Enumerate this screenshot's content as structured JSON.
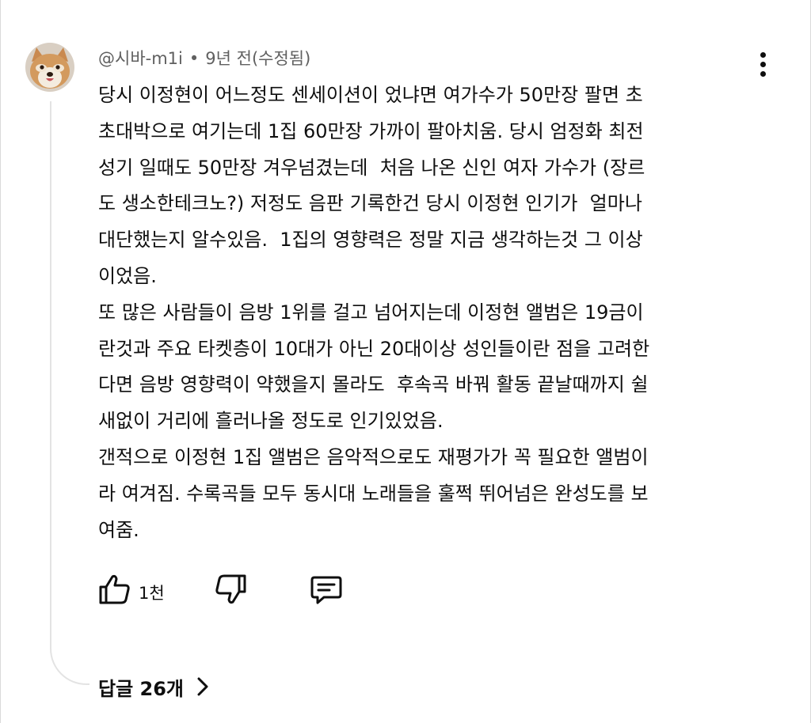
{
  "comment": {
    "author": "@시바-m1i",
    "separator": "•",
    "timestamp": "9년 전(수정됨)",
    "lines": [
      "당시 이정현이 어느정도 센세이션이 었냐면 여가수가 50만장 팔면 초",
      "초대박으로 여기는데 1집 60만장 가까이 팔아치움. 당시 엄정화 최전",
      "성기 일때도 50만장 겨우넘겼는데  처음 나온 신인 여자 가수가 (장르",
      "도 생소한테크노?) 저정도 음판 기록한건 당시 이정현 인기가  얼마나",
      "대단했는지 알수있음.  1집의 영향력은 정말 지금 생각하는것 그 이상",
      "이었음.",
      "또 많은 사람들이 음방 1위를 걸고 넘어지는데 이정현 앨범은 19금이",
      "란것과 주요 타켓층이 10대가 아닌 20대이상 성인들이란 점을 고려한",
      "다면 음방 영향력이 약했을지 몰라도  후속곡 바꿔 활동 끝날때까지 쉴",
      "새없이 거리에 흘러나올 정도로 인기있었음.",
      "갠적으로 이정현 1집 앨범은 음악적으로도 재평가가 꼭 필요한 앨범이",
      "라 여겨짐. 수록곡들 모두 동시대 노래들을 훌쩍 뛰어넘은 완성도를 보",
      "여줌."
    ]
  },
  "actions": {
    "like_icon": "thumbs-up-icon",
    "like_count": "1천",
    "dislike_icon": "thumbs-down-icon",
    "reply_icon": "comment-icon"
  },
  "replies": {
    "label": "답글 26개",
    "icon": "chevron-right-icon"
  },
  "menu_icon": "more-vertical-icon"
}
